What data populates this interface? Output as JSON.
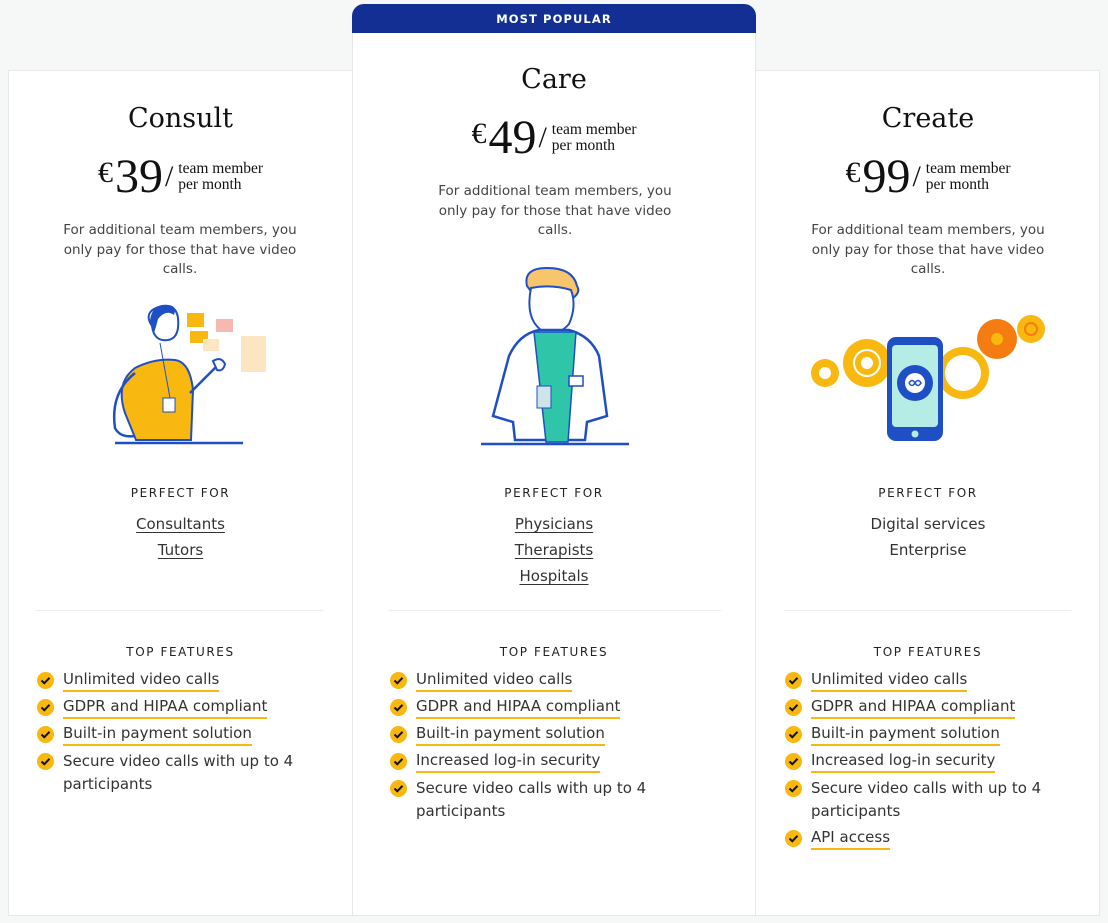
{
  "banner": "MOST POPULAR",
  "common": {
    "description": "For additional team members, you only pay for those that have video calls.",
    "perfect_for_label": "PERFECT FOR",
    "top_features_label": "TOP FEATURES",
    "currency": "€",
    "unit_line1": "team member",
    "unit_line2": "per month"
  },
  "plans": [
    {
      "name": "Consult",
      "price": "39",
      "illustration": "woman-with-sticky-notes",
      "perfect_for": [
        "Consultants",
        "Tutors"
      ],
      "features": [
        "Unlimited video calls",
        "GDPR and HIPAA compliant",
        "Built-in payment solution",
        "Secure video calls with up to 4 participants"
      ]
    },
    {
      "name": "Care",
      "price": "49",
      "illustration": "doctor",
      "perfect_for": [
        "Physicians",
        "Therapists",
        "Hospitals"
      ],
      "features": [
        "Unlimited video calls",
        "GDPR and HIPAA compliant",
        "Built-in payment solution",
        "Increased log-in security",
        "Secure video calls with up to 4 participants"
      ]
    },
    {
      "name": "Create",
      "price": "99",
      "illustration": "phone-with-gears",
      "perfect_for": [
        "Digital services",
        "Enterprise"
      ],
      "features": [
        "Unlimited video calls",
        "GDPR and HIPAA compliant",
        "Built-in payment solution",
        "Increased log-in security",
        "Secure video calls with up to 4 participants",
        "API access"
      ]
    }
  ],
  "colors": {
    "accent": "#f8b80f",
    "banner": "#132f94",
    "illustration_blue": "#1f4fc4"
  }
}
